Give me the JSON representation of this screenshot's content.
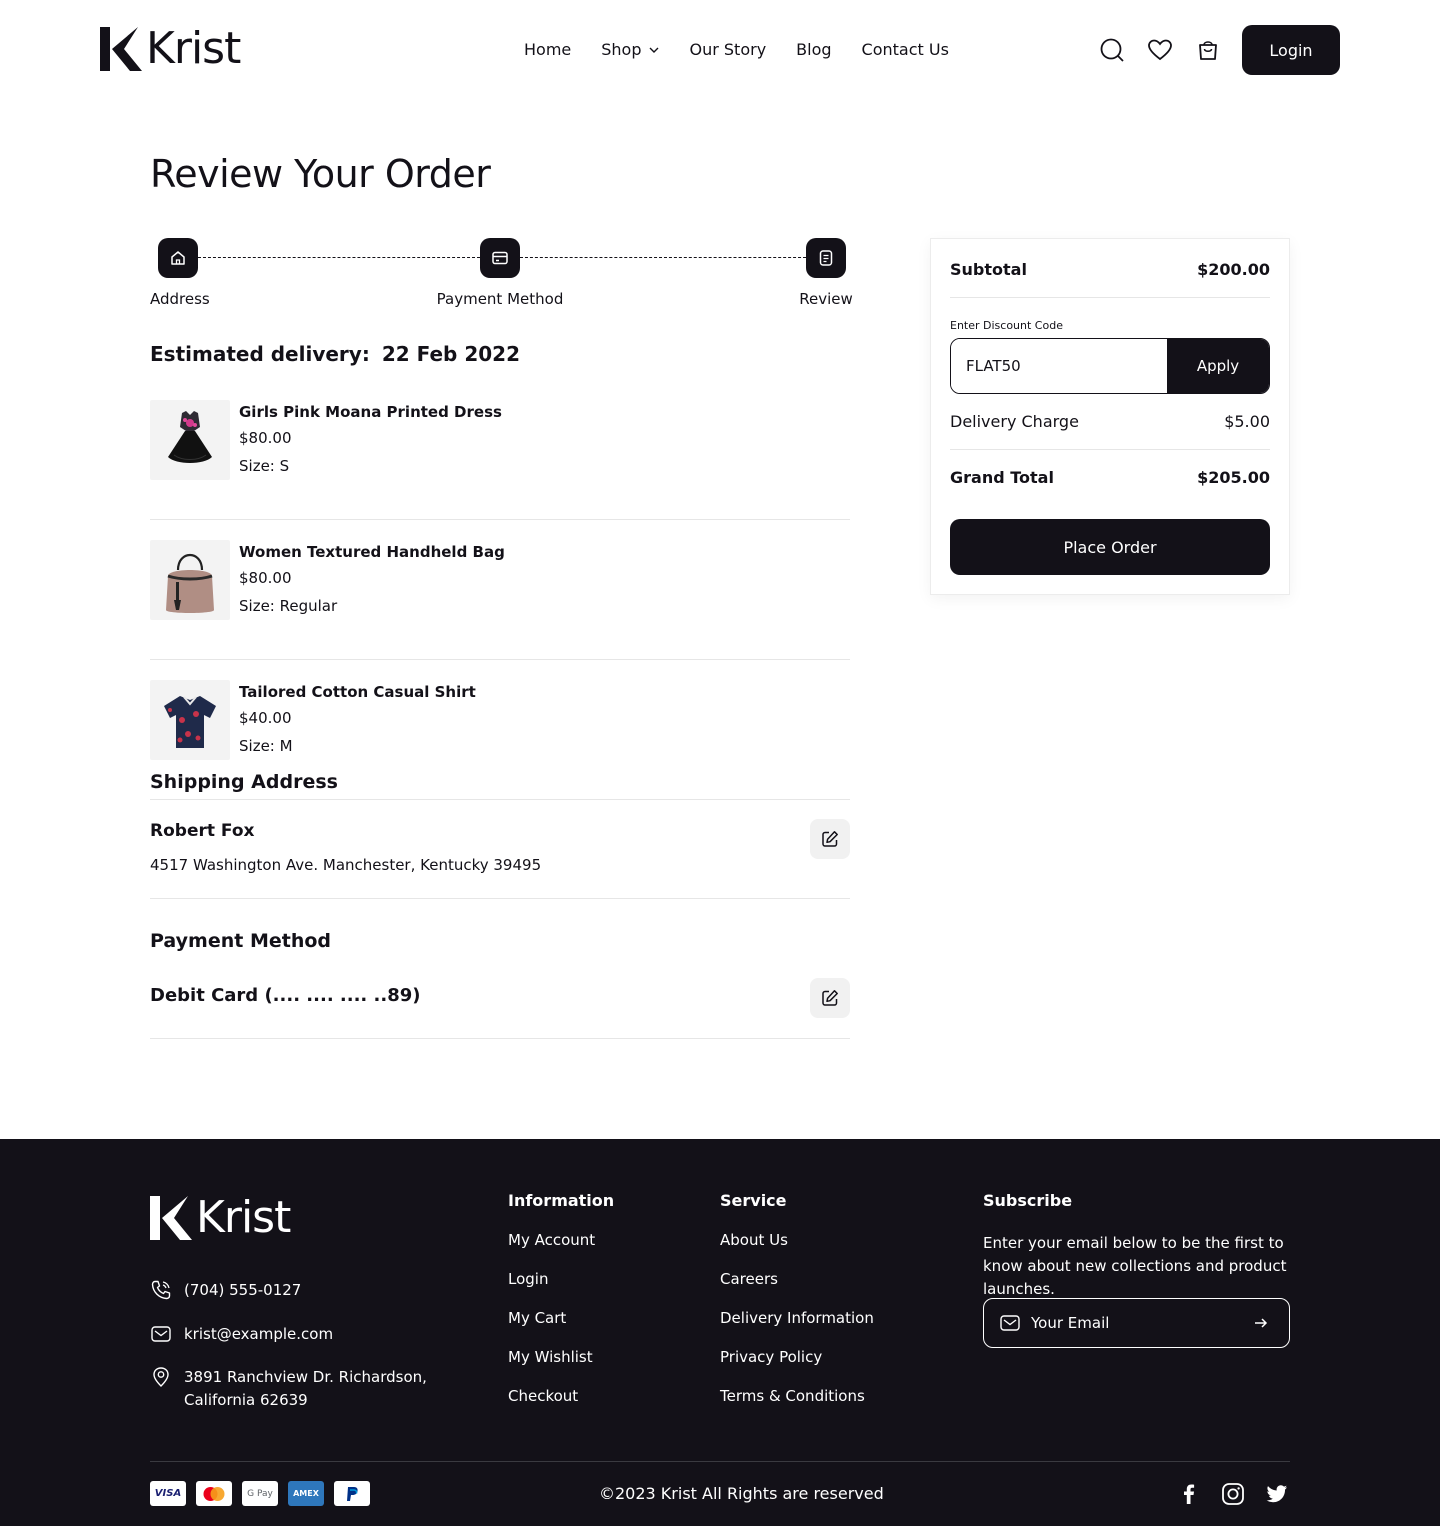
{
  "brand": {
    "name": "Krist"
  },
  "nav": {
    "items": [
      "Home",
      "Shop",
      "Our Story",
      "Blog",
      "Contact Us"
    ]
  },
  "header": {
    "login_label": "Login",
    "icons": [
      "search-icon",
      "heart-icon",
      "cart-icon"
    ]
  },
  "page": {
    "title": "Review Your Order"
  },
  "stepper": {
    "steps": [
      {
        "label": "Address",
        "icon": "home-icon"
      },
      {
        "label": "Payment Method",
        "icon": "card-icon"
      },
      {
        "label": "Review",
        "icon": "document-icon"
      }
    ]
  },
  "delivery": {
    "label": "Estimated delivery:",
    "date": "22 Feb 2022"
  },
  "products": [
    {
      "name": "Girls Pink Moana Printed Dress",
      "price": "$80.00",
      "size": "Size: S"
    },
    {
      "name": "Women Textured Handheld Bag",
      "price": "$80.00",
      "size": "Size: Regular"
    },
    {
      "name": "Tailored Cotton Casual Shirt",
      "price": "$40.00",
      "size": "Size: M"
    }
  ],
  "shipping": {
    "title": "Shipping Address",
    "name": "Robert Fox",
    "address": "4517 Washington Ave. Manchester, Kentucky 39495"
  },
  "payment": {
    "title": "Payment Method",
    "card": "Debit Card (.... .... .... ..89)"
  },
  "summary": {
    "subtotal_label": "Subtotal",
    "subtotal": "$200.00",
    "discount_label": "Enter Discount Code",
    "discount_value": "FLAT50",
    "apply_label": "Apply",
    "delivery_label": "Delivery Charge",
    "delivery": "$5.00",
    "grand_label": "Grand Total",
    "grand": "$205.00",
    "place_label": "Place Order"
  },
  "footer": {
    "contact": {
      "phone": "(704) 555-0127",
      "email": "krist@example.com",
      "address_line1": "3891 Ranchview Dr. Richardson,",
      "address_line2": "California 62639"
    },
    "information": {
      "title": "Information",
      "links": [
        "My Account",
        "Login",
        "My Cart",
        "My Wishlist",
        "Checkout"
      ]
    },
    "service": {
      "title": "Service",
      "links": [
        "About Us",
        "Careers",
        "Delivery Information",
        "Privacy Policy",
        "Terms & Conditions"
      ]
    },
    "subscribe": {
      "title": "Subscribe",
      "text": "Enter your email below to be the first to know about new collections and product launches.",
      "placeholder": "Your Email"
    },
    "payments": [
      "VISA",
      "Mastercard",
      "G Pay",
      "AMEX",
      "PayPal"
    ],
    "copyright": "©2023 Krist All Rights are reserved",
    "social": [
      "facebook-icon",
      "instagram-icon",
      "twitter-icon"
    ]
  },
  "colors": {
    "primary": "#131118",
    "border": "#e6e6e6",
    "edit_bg": "#f1f1f1"
  }
}
